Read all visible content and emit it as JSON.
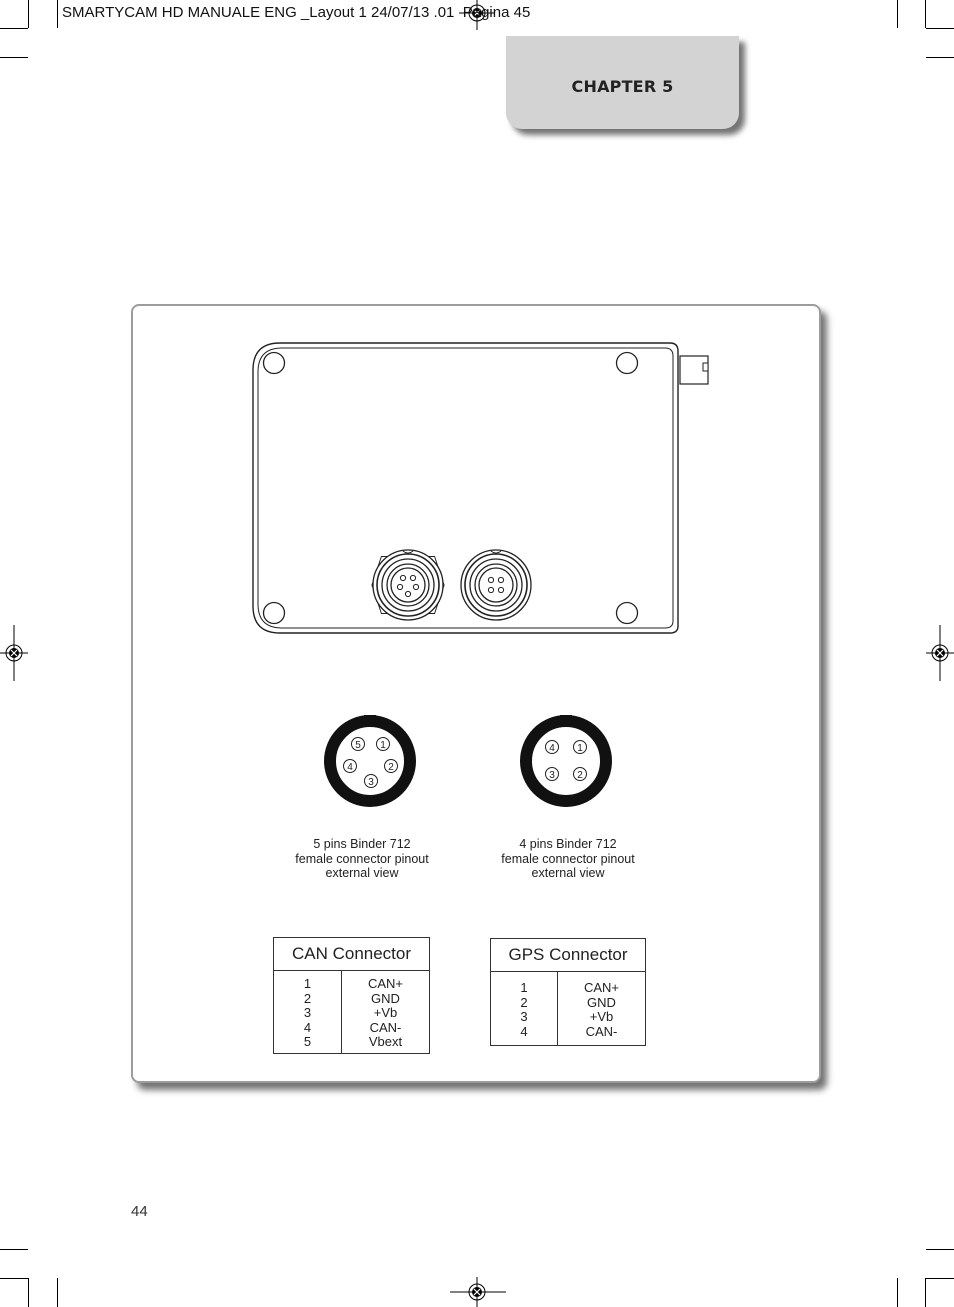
{
  "print_slug": {
    "text": "SMARTYCAM HD MANUALE ENG _Layout 1  24/07/13  ",
    "time_fragment": ".01",
    "page_label": "  Pagina 45"
  },
  "chapter_tab": {
    "label": "CHAPTER 5"
  },
  "figure": {
    "device_drawing": {
      "connectors": [
        {
          "name": "CAN connector socket",
          "pins": 5
        },
        {
          "name": "GPS connector socket",
          "pins": 4
        }
      ]
    },
    "pinouts": [
      {
        "pins": [
          "5",
          "1",
          "4",
          "2",
          "3"
        ],
        "caption": [
          "5 pins Binder 712",
          "female connector pinout",
          "external view"
        ]
      },
      {
        "pins": [
          "4",
          "1",
          "3",
          "2"
        ],
        "caption": [
          "4 pins Binder 712",
          "female connector pinout",
          "external view"
        ]
      }
    ],
    "tables": [
      {
        "title": "CAN Connector",
        "rows": [
          {
            "pin": "1",
            "signal": "CAN+"
          },
          {
            "pin": "2",
            "signal": "GND"
          },
          {
            "pin": "3",
            "signal": "+Vb"
          },
          {
            "pin": "4",
            "signal": "CAN-"
          },
          {
            "pin": "5",
            "signal": "Vbext"
          }
        ]
      },
      {
        "title": "GPS Connector",
        "rows": [
          {
            "pin": "1",
            "signal": "CAN+"
          },
          {
            "pin": "2",
            "signal": "GND"
          },
          {
            "pin": "3",
            "signal": "+Vb"
          },
          {
            "pin": "4",
            "signal": "CAN-"
          }
        ]
      }
    ]
  },
  "footer": {
    "page_number": "44"
  }
}
